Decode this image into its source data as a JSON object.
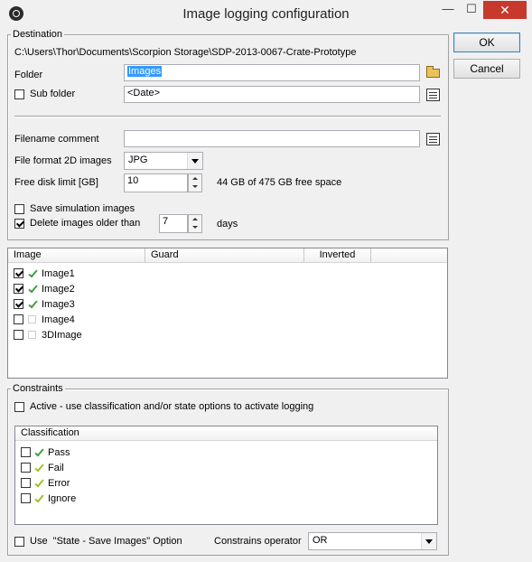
{
  "window": {
    "title": "Image logging configuration"
  },
  "title_buttons": {
    "minimize": "—",
    "maximize": "☐",
    "close": "✕"
  },
  "buttons": {
    "ok": "OK",
    "cancel": "Cancel"
  },
  "destination": {
    "legend": "Destination",
    "path": "C:\\Users\\Thor\\Documents\\Scorpion Storage\\SDP-2013-0067-Crate-Prototype",
    "folder_label": "Folder",
    "folder_value": "Images",
    "sub_folder_label": "Sub folder",
    "sub_folder_checked": false,
    "sub_folder_value": "<Date>",
    "filename_comment_label": "Filename comment",
    "filename_comment_value": "",
    "file_format_label": "File format 2D images",
    "file_format_value": "JPG",
    "free_disk_label": "Free disk limit [GB]",
    "free_disk_value": "10",
    "free_disk_info": "44 GB of 475 GB free space",
    "save_simulation_label": "Save simulation images",
    "save_simulation_checked": false,
    "delete_older_label": "Delete images older than",
    "delete_older_checked": true,
    "delete_older_value": "7",
    "delete_older_unit": "days"
  },
  "image_list": {
    "columns": [
      "Image",
      "Guard",
      "Inverted"
    ],
    "rows": [
      {
        "name": "Image1",
        "checked": true,
        "status": "ok"
      },
      {
        "name": "Image2",
        "checked": true,
        "status": "ok"
      },
      {
        "name": "Image3",
        "checked": true,
        "status": "ok"
      },
      {
        "name": "Image4",
        "checked": false,
        "status": "none"
      },
      {
        "name": "3DImage",
        "checked": false,
        "status": "none"
      }
    ]
  },
  "constraints": {
    "legend": "Constraints",
    "active_label": "Active - use classification and/or state options to activate logging",
    "active_checked": false,
    "classification_header": "Classification",
    "classifications": [
      {
        "name": "Pass",
        "checked": false,
        "tick": "green"
      },
      {
        "name": "Fail",
        "checked": false,
        "tick": "yellow"
      },
      {
        "name": "Error",
        "checked": false,
        "tick": "yellow"
      },
      {
        "name": "Ignore",
        "checked": false,
        "tick": "yellow"
      }
    ],
    "use_state_label": "Use  \"State - Save Images\" Option",
    "use_state_checked": false,
    "operator_label": "Constrains operator",
    "operator_value": "OR"
  },
  "colors": {
    "selection": "#3399ff",
    "close": "#c7382d"
  }
}
